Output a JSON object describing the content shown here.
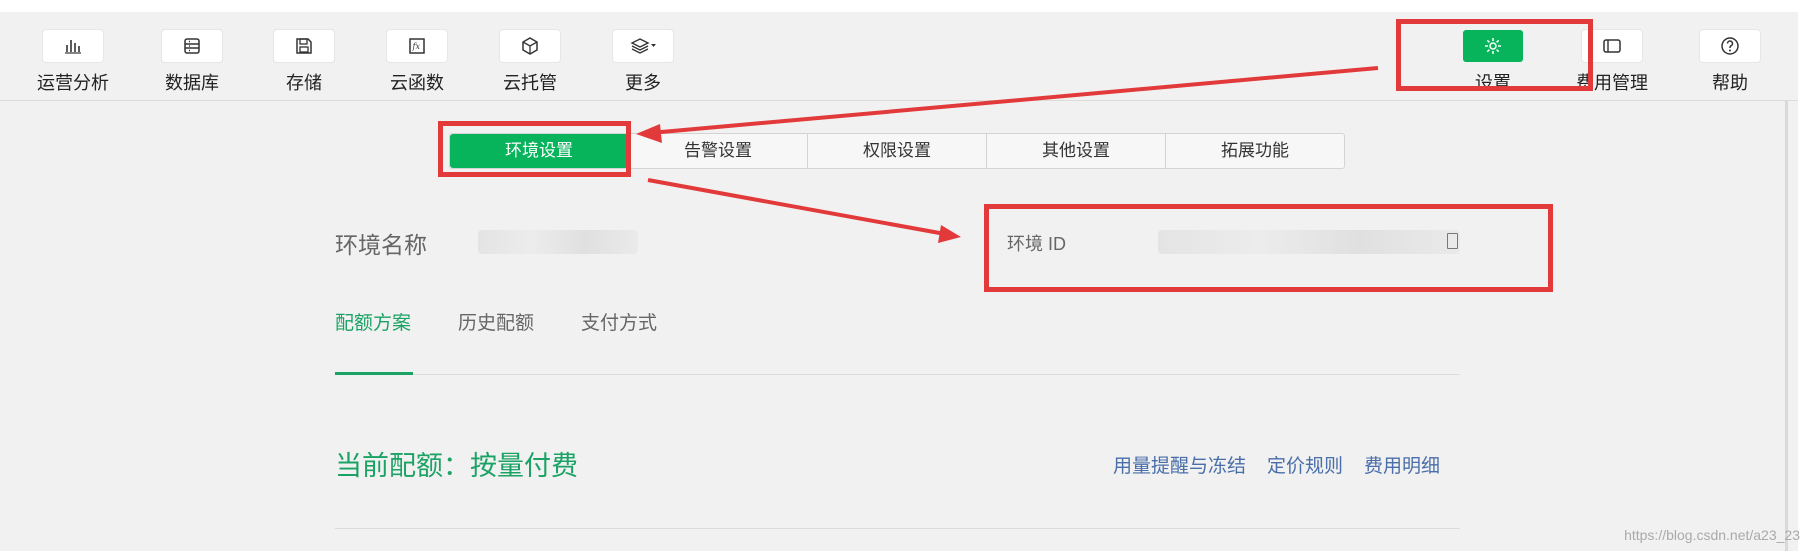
{
  "toolbar": {
    "items": [
      {
        "label": "运营分析",
        "icon": "bar-chart-icon"
      },
      {
        "label": "数据库",
        "icon": "database-icon"
      },
      {
        "label": "存储",
        "icon": "save-icon"
      },
      {
        "label": "云函数",
        "icon": "function-icon"
      },
      {
        "label": "云托管",
        "icon": "box-icon"
      },
      {
        "label": "更多",
        "icon": "layers-icon"
      },
      {
        "label": "设置",
        "icon": "gear-icon",
        "active": true
      },
      {
        "label": "费用管理",
        "icon": "card-icon"
      },
      {
        "label": "帮助",
        "icon": "help-icon"
      }
    ]
  },
  "subnav": {
    "items": [
      "环境设置",
      "告警设置",
      "权限设置",
      "其他设置",
      "拓展功能"
    ],
    "active": 0
  },
  "env": {
    "name_label": "环境名称",
    "id_label": "环境 ID"
  },
  "tabs": {
    "items": [
      "配额方案",
      "历史配额",
      "支付方式"
    ],
    "active": 0
  },
  "plan": {
    "current": "当前配额：按量付费",
    "links": [
      "用量提醒与冻结",
      "定价规则",
      "费用明细"
    ]
  },
  "watermark": "https://blog.csdn.net/a23_23",
  "colors": {
    "accent": "#07b35b",
    "link": "#4a6ea9",
    "annotation": "#e23a3a"
  }
}
